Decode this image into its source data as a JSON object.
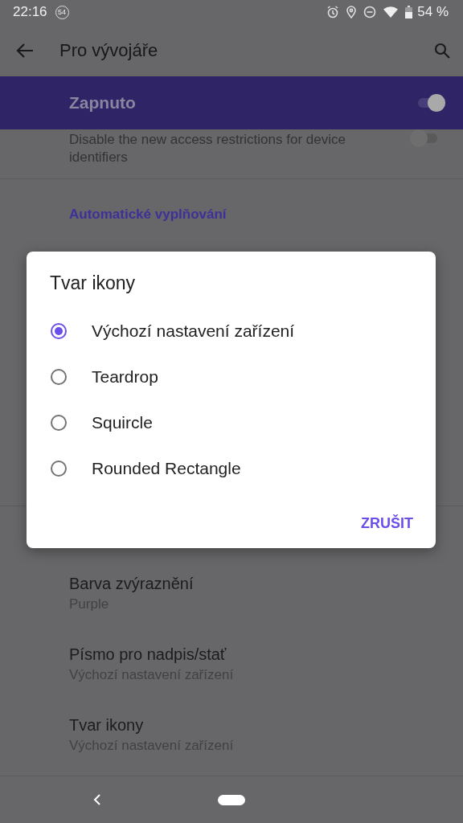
{
  "status_bar": {
    "time": "22:16",
    "notification_badge": "54",
    "battery": "54 %"
  },
  "app_bar": {
    "title": "Pro vývojáře"
  },
  "main_switch": {
    "label": "Zapnuto",
    "on": true
  },
  "settings_top": [
    {
      "kind": "switch",
      "title": "Disable the new access restrictions for device identifiers",
      "on": false
    },
    {
      "kind": "category",
      "title": "Automatické vyplňování"
    }
  ],
  "settings_bottom": [
    {
      "kind": "item",
      "title": "Barva zvýraznění",
      "summary": "Purple"
    },
    {
      "kind": "item",
      "title": "Písmo pro nadpis/stať",
      "summary": "Výchozí nastavení zařízení"
    },
    {
      "kind": "item",
      "title": "Tvar ikony",
      "summary": "Výchozí nastavení zařízení"
    }
  ],
  "dialog": {
    "title": "Tvar ikony",
    "options": [
      {
        "label": "Výchozí nastavení zařízení",
        "selected": true
      },
      {
        "label": "Teardrop",
        "selected": false
      },
      {
        "label": "Squircle",
        "selected": false
      },
      {
        "label": "Rounded Rectangle",
        "selected": false
      }
    ],
    "buttons": [
      "ZRUŠIT"
    ]
  }
}
